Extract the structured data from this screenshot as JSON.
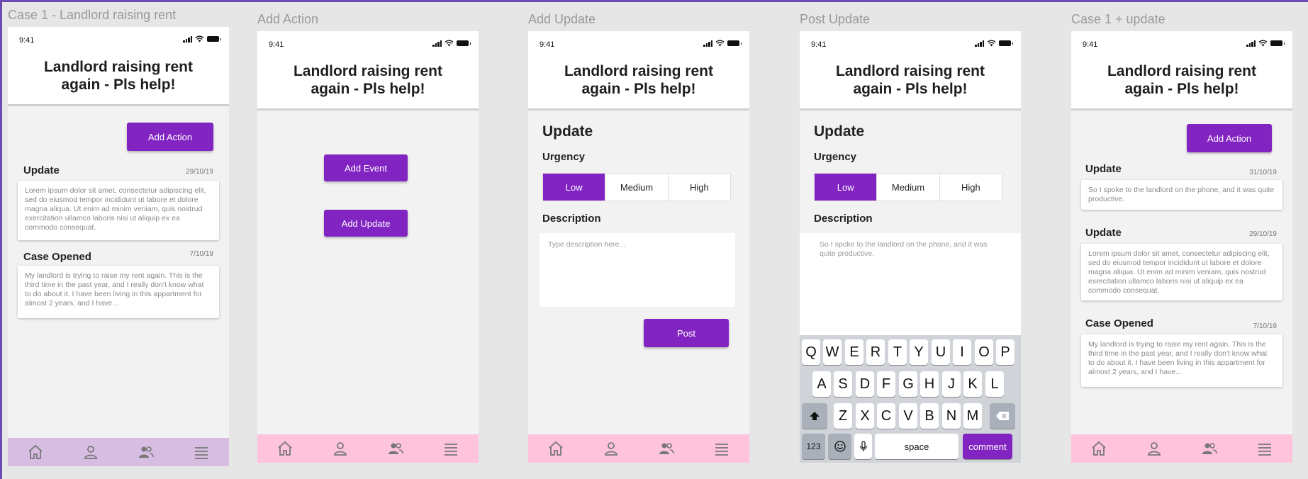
{
  "frames": [
    {
      "label": "Case 1 - Landlord raising rent"
    },
    {
      "label": "Add Action"
    },
    {
      "label": "Add Update"
    },
    {
      "label": "Post Update"
    },
    {
      "label": "Case 1 + update"
    }
  ],
  "status": {
    "time": "9:41"
  },
  "title": "Landlord raising rent again - Pls help!",
  "buttons": {
    "add_action": "Add Action",
    "add_event": "Add Event",
    "add_update": "Add Update",
    "post": "Post"
  },
  "case1": {
    "update": {
      "heading": "Update",
      "date": "29/10/19",
      "text": "Lorem ipsum dolor sit amet, consectetur adipiscing elit, sed do eiusmod tempor incididunt ut labore et dolore magna aliqua. Ut enim ad minim veniam, quis nostrud exercitation ullamco laboris nisi ut aliquip ex ea commodo consequat."
    },
    "opened": {
      "heading": "Case Opened",
      "date": "7/10/19",
      "text": "My landlord is trying to raise my rent again. This is the third time in the past year, and I really don't know what to do about it. I have been living in this appartment for almost 2 years, and I have..."
    }
  },
  "form": {
    "title": "Update",
    "urgency_label": "Urgency",
    "urgency_options": [
      "Low",
      "Medium",
      "High"
    ],
    "selected": "Low",
    "description_label": "Description",
    "placeholder": "Type description here...",
    "typed_text": "So I spoke to the landlord on the phone, and it was quite productive."
  },
  "keyboard": {
    "row1": [
      "Q",
      "W",
      "E",
      "R",
      "T",
      "Y",
      "U",
      "I",
      "O",
      "P"
    ],
    "row2": [
      "A",
      "S",
      "D",
      "F",
      "G",
      "H",
      "J",
      "K",
      "L"
    ],
    "row3": [
      "Z",
      "X",
      "C",
      "V",
      "B",
      "N",
      "M"
    ],
    "numbers": "123",
    "space": "space",
    "action": "comment"
  },
  "case1_updated": {
    "new_update": {
      "heading": "Update",
      "date": "31/10/19",
      "text": "So I spoke to the landlord on the phone, and it was quite productive."
    },
    "update": {
      "heading": "Update",
      "date": "29/10/19",
      "text": "Lorem ipsum dolor sit amet, consectetur adipiscing elit, sed do eiusmod tempor incididunt ut labore et dolore magna aliqua. Ut enim ad minim veniam, quis nostrud exercitation ullamco laboris nisi ut aliquip ex ea commodo consequat."
    },
    "opened": {
      "heading": "Case Opened",
      "date": "7/10/19",
      "text": "My landlord is trying to raise my rent again. This is the third time in the past year, and I really don't know what to do about it. I have been living in this appartment for almost 2 years, and I have..."
    }
  },
  "icons": {
    "nav": [
      "home-icon",
      "profile-icon",
      "community-icon",
      "menu-icon"
    ]
  },
  "colors": {
    "accent": "#8224c2",
    "nav_pink": "#ffc3dc",
    "nav_lavender": "#d7bde2",
    "frame_border": "#6a4bb3"
  }
}
